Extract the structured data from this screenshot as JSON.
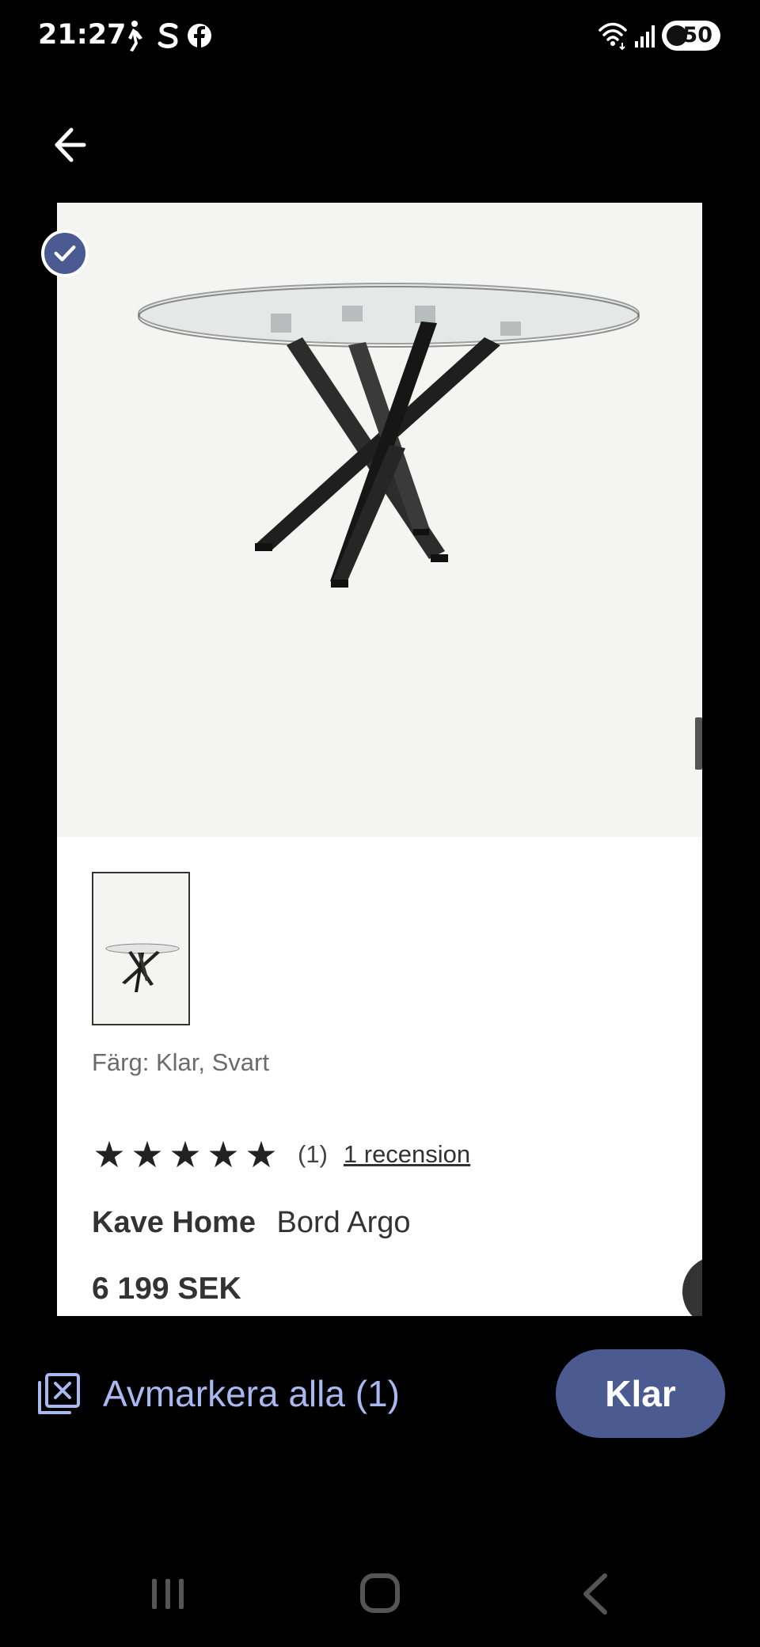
{
  "status_bar": {
    "time": "21:27",
    "battery": "50",
    "icons": [
      "walking-icon",
      "s-app-icon",
      "facebook-icon",
      "wifi-icon",
      "signal-icon",
      "battery-icon"
    ]
  },
  "header": {
    "back_icon": "arrow-left-icon"
  },
  "product": {
    "image_alt": "Bord Argo",
    "color": "Färg: Klar, Svart",
    "rating_stars": 5,
    "rating_count": "(1)",
    "review_link": "1 recension",
    "brand": "Kave Home",
    "name": "Bord Argo",
    "price": "6 199 SEK",
    "selected": true
  },
  "actions": {
    "deselect_label": "Avmarkera alla (1)",
    "done_label": "Klar"
  },
  "colors": {
    "accent": "#4b5b92",
    "link_light": "#aab8f0",
    "background": "#000000"
  }
}
